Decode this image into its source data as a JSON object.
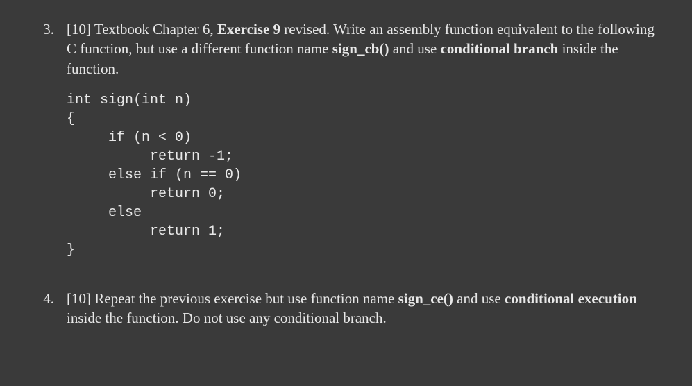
{
  "q3": {
    "num": "3.",
    "prose_parts": {
      "p1": "[10] Textbook Chapter 6, ",
      "b1": "Exercise 9",
      "p2": " revised. Write an assembly function equivalent to the following C function, but use a different function name ",
      "b2": "sign_cb()",
      "p3": " and use ",
      "b3": "conditional branch",
      "p4": " inside the function."
    },
    "code": "int sign(int n)\n{\n     if (n < 0)\n          return -1;\n     else if (n == 0)\n          return 0;\n     else\n          return 1;\n}"
  },
  "q4": {
    "num": "4.",
    "prose_parts": {
      "p1": "[10] Repeat the previous exercise but use function name ",
      "b1": "sign_ce()",
      "p2": " and use ",
      "b2": "conditional execution",
      "p3": " inside the function. Do not use any conditional branch."
    }
  }
}
